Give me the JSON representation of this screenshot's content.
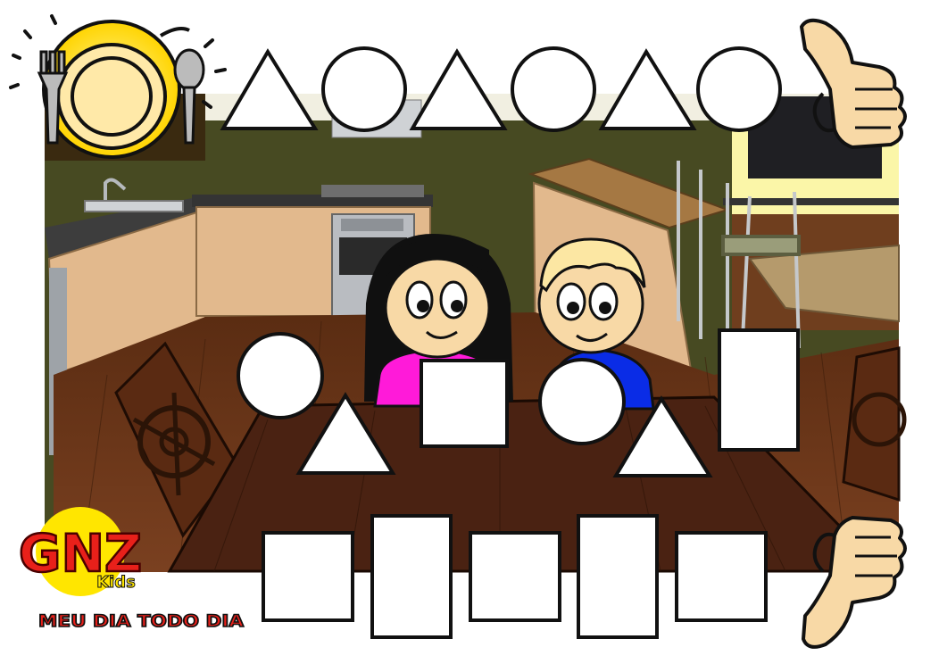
{
  "game": {
    "logo_text": "GNZ",
    "logo_subtext": "Kids",
    "tagline": "MEU DIA TODO DIA"
  },
  "top_row": [
    {
      "shape": "triangle"
    },
    {
      "shape": "circle"
    },
    {
      "shape": "triangle"
    },
    {
      "shape": "circle"
    },
    {
      "shape": "triangle"
    },
    {
      "shape": "circle"
    }
  ],
  "table_shapes": [
    {
      "shape": "circle"
    },
    {
      "shape": "triangle"
    },
    {
      "shape": "square"
    },
    {
      "shape": "circle"
    },
    {
      "shape": "triangle"
    },
    {
      "shape": "tall-rectangle"
    }
  ],
  "bottom_row": [
    {
      "shape": "square"
    },
    {
      "shape": "tall-rectangle"
    },
    {
      "shape": "square"
    },
    {
      "shape": "tall-rectangle"
    },
    {
      "shape": "square"
    }
  ],
  "icons": {
    "meal": "plate-fork-spoon-icon",
    "approve": "thumbs-up-icon",
    "reject": "thumbs-down-icon"
  },
  "colors": {
    "logo_yellow": "#ffe600",
    "logo_red": "#e8201a",
    "meal_yellow": "#fff200",
    "wall_olive": "#474a22",
    "floor_wood": "#6b3618",
    "table_wood": "#4a2212",
    "girl_shirt": "#ff1ad9",
    "boy_shirt": "#0a2ce6",
    "skin": "#f8d9a6"
  }
}
